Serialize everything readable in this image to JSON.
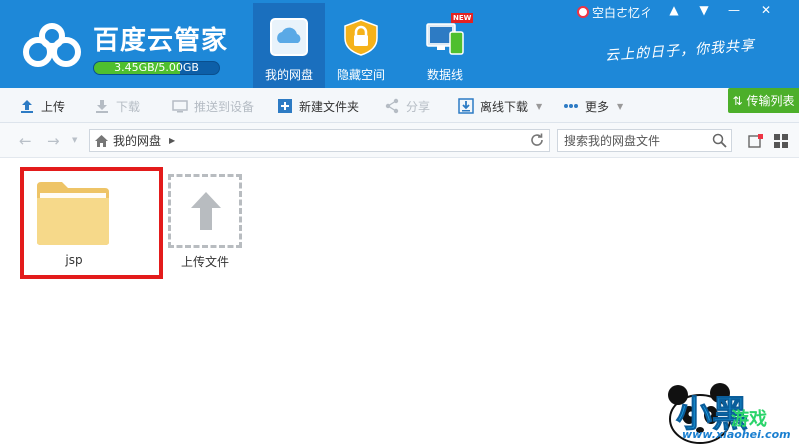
{
  "app": {
    "name": "百度云管家",
    "quota_text": "3.45GB/5.00GB",
    "quota_used_fraction": 0.69,
    "slogan": "云上的日子，你我共享"
  },
  "nav_tabs": [
    {
      "label": "我的网盘",
      "icon": "cloud-drive-icon",
      "active": true
    },
    {
      "label": "隐藏空间",
      "icon": "lock-icon",
      "active": false
    },
    {
      "label": "数据线",
      "icon": "device-sync-icon",
      "active": false,
      "badge": "NEW"
    }
  ],
  "user": {
    "username": "空白ㄜ忆ㄔ"
  },
  "window_controls": [
    {
      "icon": "bell-icon",
      "label": "▲"
    },
    {
      "icon": "menu-icon",
      "label": "▼"
    },
    {
      "icon": "minimize-icon",
      "label": "—"
    },
    {
      "icon": "close-icon",
      "label": "✕"
    }
  ],
  "toolbar": {
    "upload_label": "上传",
    "download_label": "下载",
    "push_label": "推送到设备",
    "new_folder_label": "新建文件夹",
    "share_label": "分享",
    "offline_label": "离线下载",
    "more_label": "更多",
    "transfer_label": "传输列表"
  },
  "address": {
    "crumb": "我的网盘",
    "search_placeholder": "搜索我的网盘文件"
  },
  "files": [
    {
      "name": "jsp",
      "type": "folder",
      "selected": true
    },
    {
      "name": "上传文件",
      "type": "upload-placeholder"
    }
  ],
  "watermark": {
    "brand": "小黑",
    "game": "游戏",
    "url": "www.xiaohei.com"
  },
  "colors": {
    "header_bg": "#1e88d8",
    "active_tab_bg": "#1a6fbe",
    "quota_green": "#4fbf2f",
    "transfer_green": "#4caf2a",
    "selection_red": "#e31b1b",
    "folder_yellow": "#f6d98a"
  }
}
